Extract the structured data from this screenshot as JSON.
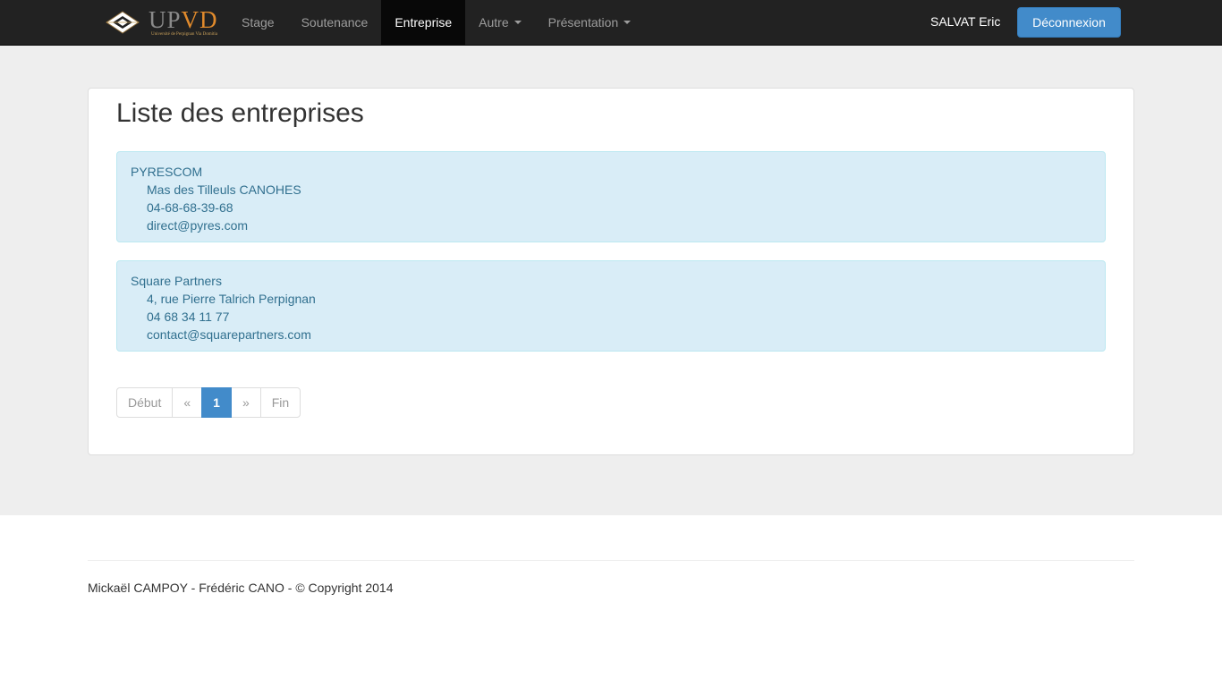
{
  "navbar": {
    "brand": {
      "logo_text_a": "UP",
      "logo_text_b": "VD",
      "subtitle": "Université de Perpignan Via Domitia"
    },
    "items": [
      {
        "label": "Stage",
        "active": false
      },
      {
        "label": "Soutenance",
        "active": false
      },
      {
        "label": "Entreprise",
        "active": true
      },
      {
        "label": "Autre",
        "active": false,
        "dropdown": true
      },
      {
        "label": "Présentation",
        "active": false,
        "dropdown": true
      }
    ],
    "user_name": "SALVAT Eric",
    "logout_label": "Déconnexion"
  },
  "main": {
    "title": "Liste des entreprises",
    "companies": [
      {
        "name": "PYRESCOM",
        "address": "Mas des Tilleuls CANOHES",
        "phone": "04-68-68-39-68",
        "email": "direct@pyres.com"
      },
      {
        "name": "Square Partners",
        "address": "4, rue Pierre Talrich Perpignan",
        "phone": "04 68 34 11 77",
        "email": "contact@squarepartners.com"
      }
    ],
    "pagination": {
      "first": "Début",
      "prev": "«",
      "current": "1",
      "next": "»",
      "last": "Fin"
    }
  },
  "footer": {
    "text": "Mickaël CAMPOY - Frédéric CANO - © Copyright 2014"
  },
  "colors": {
    "navbar_bg": "#222222",
    "accent": "#428bca",
    "info_bg": "#d9edf7",
    "info_text": "#31708f",
    "logo_orange": "#e08a2c"
  }
}
